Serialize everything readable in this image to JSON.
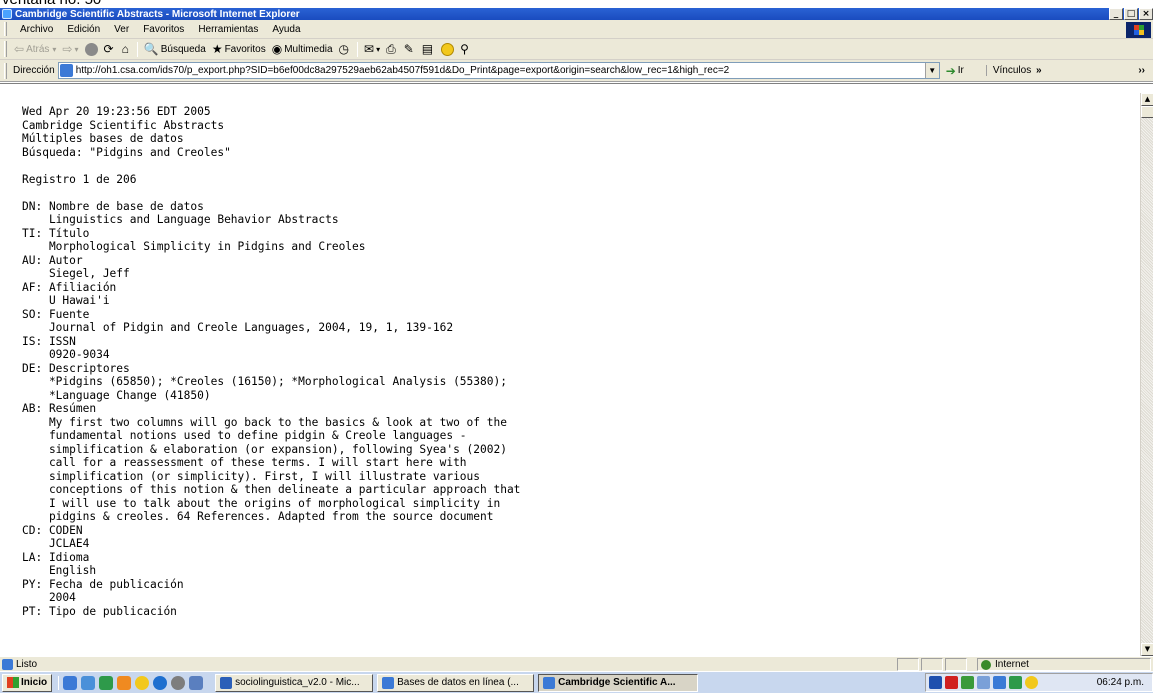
{
  "caption": "ventana no. 50",
  "window": {
    "title": "Cambridge Scientific Abstracts - Microsoft Internet Explorer"
  },
  "menu": [
    "Archivo",
    "Edición",
    "Ver",
    "Favoritos",
    "Herramientas",
    "Ayuda"
  ],
  "toolbar": {
    "back": "Atrás",
    "search": "Búsqueda",
    "favorites": "Favoritos",
    "media": "Multimedia"
  },
  "address": {
    "label": "Dirección",
    "url": "http://oh1.csa.com/ids70/p_export.php?SID=b6ef00dc8a297529aeb62ab4507f591d&Do_Print&page=export&origin=search&low_rec=1&high_rec=2",
    "go": "Ir",
    "links": "Vínculos"
  },
  "document": {
    "lines": [
      "Wed Apr 20 19:23:56 EDT 2005",
      "Cambridge Scientific Abstracts",
      "Múltiples bases de datos",
      "Búsqueda: \"Pidgins and Creoles\"",
      "",
      "Registro 1 de 206",
      "",
      "DN: Nombre de base de datos",
      "    Linguistics and Language Behavior Abstracts",
      "TI: Título",
      "    Morphological Simplicity in Pidgins and Creoles",
      "AU: Autor",
      "    Siegel, Jeff",
      "AF: Afiliación",
      "    U Hawai'i",
      "SO: Fuente",
      "    Journal of Pidgin and Creole Languages, 2004, 19, 1, 139-162",
      "IS: ISSN",
      "    0920-9034",
      "DE: Descriptores",
      "    *Pidgins (65850); *Creoles (16150); *Morphological Analysis (55380);",
      "    *Language Change (41850)",
      "AB: Resúmen",
      "    My first two columns will go back to the basics & look at two of the",
      "    fundamental notions used to define pidgin & Creole languages -",
      "    simplification & elaboration (or expansion), following Syea's (2002)",
      "    call for a reassessment of these terms. I will start here with",
      "    simplification (or simplicity). First, I will illustrate various",
      "    conceptions of this notion & then delineate a particular approach that",
      "    I will use to talk about the origins of morphological simplicity in",
      "    pidgins & creoles. 64 References. Adapted from the source document",
      "CD: CODEN",
      "    JCLAE4",
      "LA: Idioma",
      "    English",
      "PY: Fecha de publicación",
      "    2004",
      "PT: Tipo de publicación"
    ]
  },
  "status": {
    "text": "Listo",
    "zone": "Internet"
  },
  "taskbar": {
    "start": "Inicio",
    "tasks": [
      {
        "label": "sociolinguistica_v2.0 - Mic...",
        "active": false
      },
      {
        "label": "Bases de datos en línea (...",
        "active": false
      },
      {
        "label": "Cambridge Scientific A...",
        "active": true
      }
    ],
    "clock": "06:24 p.m."
  }
}
